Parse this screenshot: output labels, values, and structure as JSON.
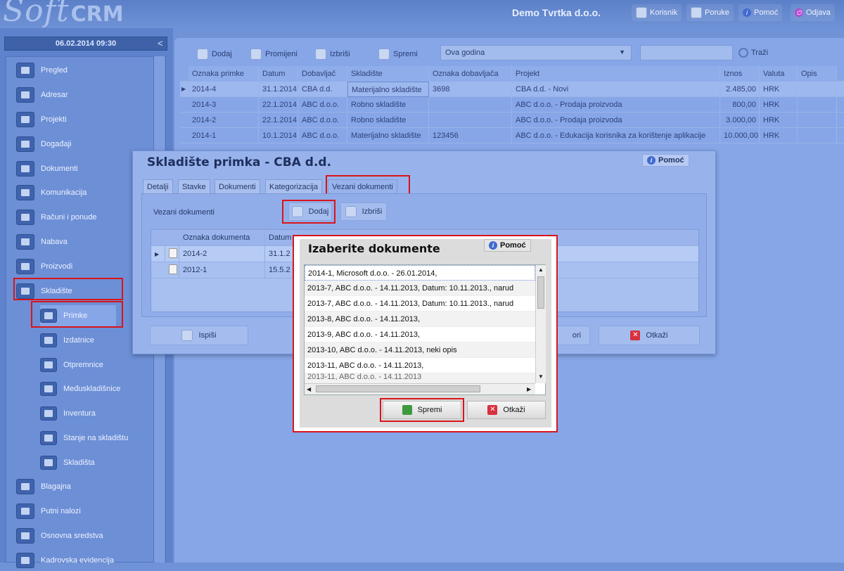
{
  "app": {
    "logo_main": "Soft",
    "logo_suffix": "CRM",
    "company": "Demo Tvrtka d.o.o."
  },
  "topbar": {
    "user": "Korisnik",
    "messages": "Poruke",
    "help": "Pomoć",
    "logout": "Odjava"
  },
  "sidebar": {
    "datetime": "06.02.2014 09:30",
    "collapse": "<",
    "items": [
      {
        "label": "Pregled"
      },
      {
        "label": "Adresar"
      },
      {
        "label": "Projekti"
      },
      {
        "label": "Događaji"
      },
      {
        "label": "Dokumenti"
      },
      {
        "label": "Komunikacija"
      },
      {
        "label": "Računi i ponude"
      },
      {
        "label": "Nabava"
      },
      {
        "label": "Proizvodi"
      },
      {
        "label": "Skladište"
      }
    ],
    "sub_items": [
      {
        "label": "Primke"
      },
      {
        "label": "Izdatnice"
      },
      {
        "label": "Otpremnice"
      },
      {
        "label": "Međuskladišnice"
      },
      {
        "label": "Inventura"
      },
      {
        "label": "Stanje na skladištu"
      },
      {
        "label": "Skladišta"
      }
    ],
    "items_after": [
      {
        "label": "Blagajna"
      },
      {
        "label": "Putni nalozi"
      },
      {
        "label": "Osnovna sredstva"
      },
      {
        "label": "Kadrovska evidencija"
      }
    ]
  },
  "toolbar": {
    "add": "Dodaj",
    "edit": "Promijeni",
    "delete": "Izbriši",
    "save": "Spremi",
    "period": "Ova godina",
    "search_value": "",
    "search": "Traži"
  },
  "grid": {
    "columns": [
      "Oznaka primke",
      "Datum",
      "Dobavljač",
      "Skladište",
      "Oznaka dobavljača",
      "Projekt",
      "Iznos",
      "Valuta",
      "Opis"
    ],
    "rows": [
      [
        "2014-4",
        "31.1.2014",
        "CBA d.d.",
        "Materijalno skladište",
        "3698",
        "CBA d.d. - Novi",
        "2.485,00",
        "HRK",
        ""
      ],
      [
        "2014-3",
        "22.1.2014",
        "ABC d.o.o.",
        "Robno skladište",
        "",
        "ABC d.o.o. - Prodaja proizvoda",
        "800,00",
        "HRK",
        ""
      ],
      [
        "2014-2",
        "22.1.2014",
        "ABC d.o.o.",
        "Robno skladište",
        "",
        "ABC d.o.o. - Prodaja proizvoda",
        "3.000,00",
        "HRK",
        ""
      ],
      [
        "2014-1",
        "10.1.2014",
        "ABC d.o.o.",
        "Materijalno skladište",
        "123456",
        "ABC d.o.o. - Edukacija korisnika za korištenje aplikacije",
        "10.000,00",
        "HRK",
        ""
      ]
    ]
  },
  "dialog1": {
    "title": "Skladište primka - CBA d.d.",
    "help": "Pomoć",
    "tabs": [
      "Detalji",
      "Stavke",
      "Dokumenti",
      "Kategorizacija",
      "Vezani dokumenti"
    ],
    "section_label": "Vezani dokumenti",
    "add": "Dodaj",
    "delete": "Izbriši",
    "columns": [
      "Oznaka dokumenta",
      "Datum"
    ],
    "rows": [
      [
        "2014-2",
        "31.1.2"
      ],
      [
        "2012-1",
        "15.5.2"
      ]
    ],
    "print": "Ispiši",
    "save_partial": "ori",
    "cancel": "Otkaži"
  },
  "dialog2": {
    "title": "Izaberite dokumente",
    "help": "Pomoć",
    "items": [
      "2014-1, Microsoft d.o.o. - 26.01.2014,",
      "2013-7, ABC d.o.o. - 14.11.2013,  Datum: 10.11.2013., narud",
      "2013-7, ABC d.o.o. - 14.11.2013,  Datum: 10.11.2013., narud",
      "2013-8, ABC d.o.o. - 14.11.2013,",
      "2013-9, ABC d.o.o. - 14.11.2013,",
      "2013-10, ABC d.o.o. - 14.11.2013,  neki opis",
      "2013-11, ABC d.o.o. - 14.11.2013,",
      "2013-11, ABC d.o.o. - 14.11.2013"
    ],
    "save": "Spremi",
    "cancel": "Otkaži"
  },
  "colors": {
    "highlight": "#d9141a",
    "accent": "#6f93d6"
  }
}
